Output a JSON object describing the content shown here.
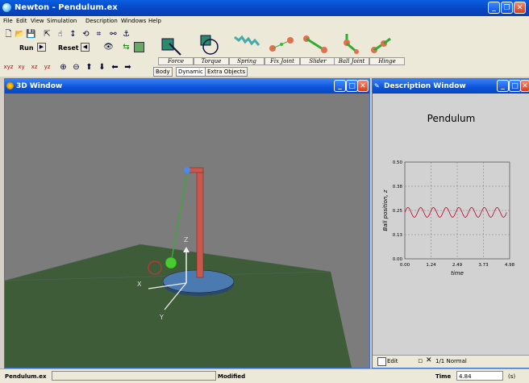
{
  "titlebar": {
    "title": "Newton - Pendulum.ex"
  },
  "menu": [
    "File",
    "Edit",
    "View",
    "Simulation",
    "Description",
    "Windows",
    "Help"
  ],
  "toolbar": {
    "run_label": "Run",
    "reset_label": "Reset",
    "tabs": [
      "Body",
      "Dynamic",
      "Extra Objects"
    ]
  },
  "joints": [
    {
      "label": "Force",
      "icon": "force-icon"
    },
    {
      "label": "Torque",
      "icon": "torque-icon"
    },
    {
      "label": "Spring",
      "icon": "spring-icon"
    },
    {
      "label": "Fix Joint",
      "icon": "fix-joint-icon"
    },
    {
      "label": "Slider",
      "icon": "slider-icon"
    },
    {
      "label": "Ball Joint",
      "icon": "ball-joint-icon"
    },
    {
      "label": "Hinge",
      "icon": "hinge-icon"
    }
  ],
  "window3d": {
    "title": "3D Window",
    "axis_z": "Z",
    "axis_x": "X",
    "axis_y": "Y"
  },
  "desc_window": {
    "title": "Description Window",
    "heading": "Pendulum",
    "edit_label": "Edit",
    "page_label": "1/1 Normal"
  },
  "chart_data": {
    "type": "line",
    "ylabel": "Ball position,  z",
    "xlabel": "time",
    "xlim": [
      0,
      4.98
    ],
    "ylim": [
      0,
      0.5
    ],
    "xticks": [
      "0.00",
      "1.24",
      "2.49",
      "3.73",
      "4.98"
    ],
    "yticks": [
      "0.00",
      "0.13",
      "0.25",
      "0.38",
      "0.50"
    ],
    "grid": true,
    "series": [
      {
        "color": "#c0002a",
        "mean": 0.24,
        "amplitude": 0.025,
        "periods": 8,
        "xmax": 4.84
      }
    ]
  },
  "status": {
    "file": "Pendulum.ex",
    "modified": "Modified",
    "time_label": "Time",
    "time_value": "4.84",
    "unit": "(s)"
  }
}
